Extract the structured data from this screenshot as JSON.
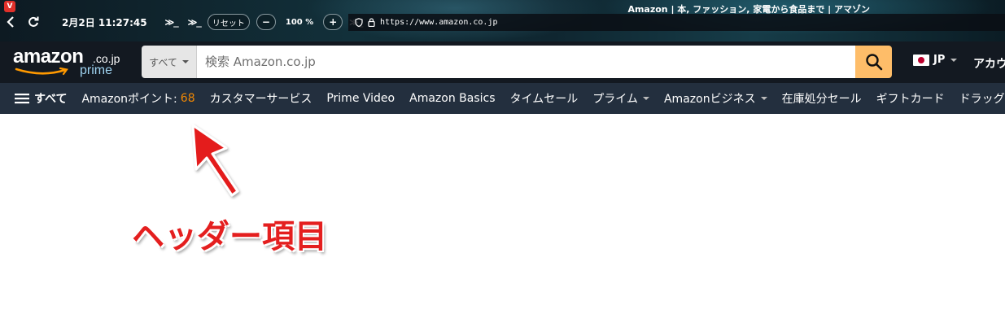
{
  "browser": {
    "window_title": "Amazon | 本, ファッション, 家電から食品まで | アマゾン",
    "clock": "2月2日  11:27:45",
    "reset_label": "リセット",
    "zoom_out_label": "−",
    "zoom_level": "100 %",
    "zoom_in_label": "+",
    "address": "https://www.amazon.co.jp",
    "cmd_glyph": "≫_"
  },
  "amazon": {
    "logo": {
      "word": "amazon",
      "tld": ".co.jp",
      "sub": "prime"
    },
    "search": {
      "category": "すべて",
      "placeholder": "検索 Amazon.co.jp"
    },
    "language": "JP",
    "account_label": "アカウ",
    "nav": {
      "all_label": "すべて",
      "points_label": "Amazonポイント: ",
      "points_value": "68",
      "items": [
        "カスタマーサービス",
        "Prime Video",
        "Amazon Basics",
        "タイムセール",
        "プライム",
        "Amazonビジネス",
        "在庫処分セール",
        "ギフトカード",
        "ドラッグス"
      ]
    }
  },
  "annotation": {
    "label": "ヘッダー項目",
    "color": "#e41f1f"
  },
  "colors": {
    "amazon_header": "#131921",
    "amazon_nav": "#232f3e",
    "search_button": "#febd69",
    "points_accent": "#f08804"
  }
}
